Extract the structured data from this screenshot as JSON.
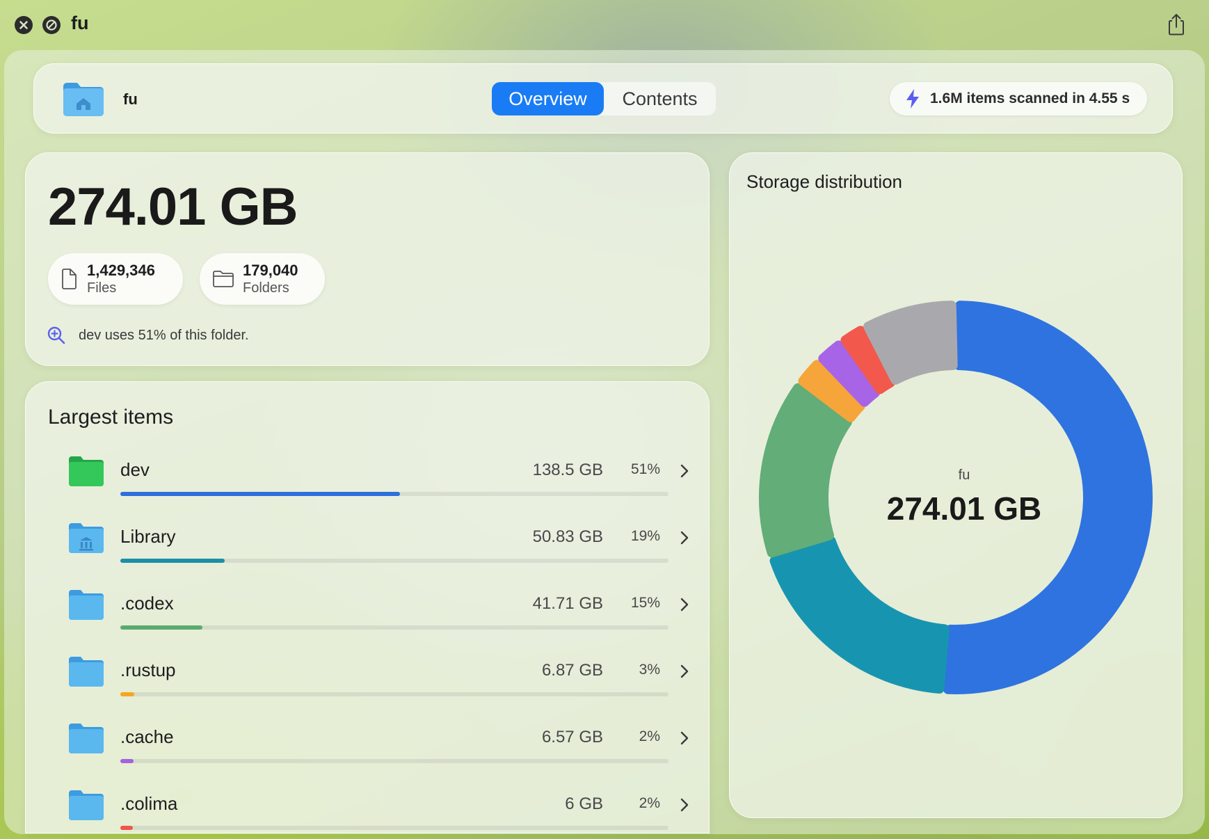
{
  "window": {
    "title": "fu"
  },
  "icons": {
    "close": "close-icon",
    "stop": "stop-icon",
    "share": "share-icon",
    "home_folder": "home-folder-icon",
    "bolt": "bolt-icon",
    "file": "file-icon",
    "folder": "folder-icon",
    "zoom": "magnifier-plus-icon",
    "chevron": "chevron-right-icon"
  },
  "header": {
    "folder_name": "fu",
    "tabs": [
      {
        "label": "Overview",
        "active": true
      },
      {
        "label": "Contents",
        "active": false
      }
    ],
    "scan_status": "1.6M items scanned in 4.55 s"
  },
  "summary": {
    "total_size": "274.01 GB",
    "files": {
      "count": "1,429,346",
      "label": "Files"
    },
    "folders": {
      "count": "179,040",
      "label": "Folders"
    },
    "insight": "dev uses 51% of this folder."
  },
  "largest": {
    "title": "Largest items",
    "items": [
      {
        "name": "dev",
        "size": "138.5 GB",
        "percent": "51%",
        "fraction": 0.51,
        "color": "#2f6fdc",
        "icon": "green-folder-icon",
        "folder_color": "#34c759"
      },
      {
        "name": "Library",
        "size": "50.83 GB",
        "percent": "19%",
        "fraction": 0.19,
        "color": "#1c8fa6",
        "icon": "library-folder-icon",
        "folder_color": "#5ab8ef"
      },
      {
        "name": ".codex",
        "size": "41.71 GB",
        "percent": "15%",
        "fraction": 0.15,
        "color": "#5aaa6e",
        "icon": "folder-icon",
        "folder_color": "#5ab8ef"
      },
      {
        "name": ".rustup",
        "size": "6.87 GB",
        "percent": "3%",
        "fraction": 0.025,
        "color": "#f5a623",
        "icon": "folder-icon",
        "folder_color": "#5ab8ef"
      },
      {
        "name": ".cache",
        "size": "6.57 GB",
        "percent": "2%",
        "fraction": 0.024,
        "color": "#a461e0",
        "icon": "folder-icon",
        "folder_color": "#5ab8ef"
      },
      {
        "name": ".colima",
        "size": "6 GB",
        "percent": "2%",
        "fraction": 0.022,
        "color": "#f0564a",
        "icon": "folder-icon",
        "folder_color": "#5ab8ef"
      }
    ]
  },
  "distribution": {
    "title": "Storage distribution",
    "center_name": "fu",
    "center_size": "274.01 GB",
    "segments": [
      {
        "item": "dev",
        "fraction": 0.51,
        "color": "#2f73e0"
      },
      {
        "item": "Library",
        "fraction": 0.19,
        "color": "#1795b0"
      },
      {
        "item": ".codex",
        "fraction": 0.15,
        "color": "#62ad78"
      },
      {
        "item": ".rustup",
        "fraction": 0.025,
        "color": "#f6a53a"
      },
      {
        "item": ".cache",
        "fraction": 0.024,
        "color": "#a864e6"
      },
      {
        "item": ".colima",
        "fraction": 0.022,
        "color": "#f2584c"
      },
      {
        "item": "other",
        "fraction": 0.079,
        "color": "#a9a9ad"
      }
    ]
  }
}
